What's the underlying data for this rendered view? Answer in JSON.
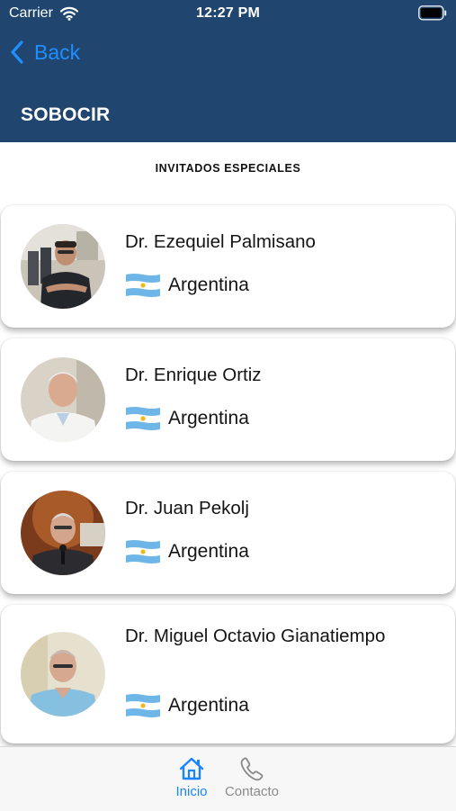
{
  "status_bar": {
    "carrier": "Carrier",
    "time": "12:27 PM"
  },
  "nav": {
    "back_label": "Back",
    "title": "SOBOCIR"
  },
  "section": {
    "title": "INVITADOS ESPECIALES"
  },
  "guests": [
    {
      "name": "Dr. Ezequiel Palmisano",
      "country": "Argentina"
    },
    {
      "name": "Dr. Enrique Ortiz",
      "country": "Argentina"
    },
    {
      "name": "Dr. Juan Pekolj",
      "country": "Argentina"
    },
    {
      "name": "Dr. Miguel Octavio Gianatiempo",
      "country": "Argentina"
    }
  ],
  "tabs": [
    {
      "label": "Inicio",
      "icon": "home-icon",
      "active": true
    },
    {
      "label": "Contacto",
      "icon": "phone-icon",
      "active": false
    }
  ],
  "colors": {
    "header": "#20466f",
    "accent": "#1b85ff",
    "back": "#1f8fff",
    "inactive_tab": "#8a8a8a",
    "flag_blue": "#6fb6e8",
    "flag_sun": "#f2b81a"
  }
}
